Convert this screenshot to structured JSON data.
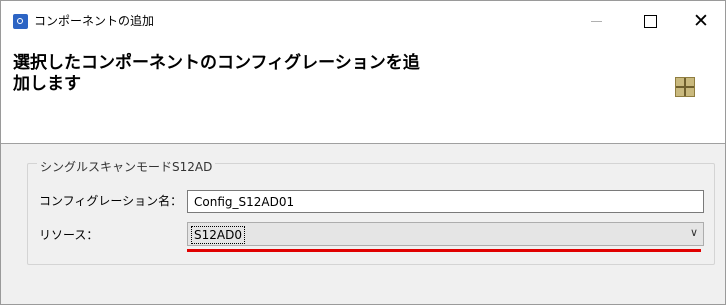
{
  "window": {
    "title": "コンポーネントの追加",
    "app_icon": "renesas-app-icon",
    "minimize_icon": "minimize-icon",
    "maximize_icon": "maximize-icon",
    "close_icon": "close-icon",
    "close_glyph": "✕"
  },
  "header": {
    "title": "選択したコンポーネントのコンフィグレーションを追加します",
    "icon": "component-grid-icon"
  },
  "group": {
    "legend": "シングルスキャンモードS12AD",
    "config_label": "コンフィグレーション名：",
    "config_value": "Config_S12AD01",
    "resource_label": "リソース：",
    "resource_value": "S12AD0",
    "dropdown_icon": "chevron-down-icon",
    "dropdown_glyph": "∨"
  },
  "colors": {
    "highlight_underline": "#e00000"
  }
}
